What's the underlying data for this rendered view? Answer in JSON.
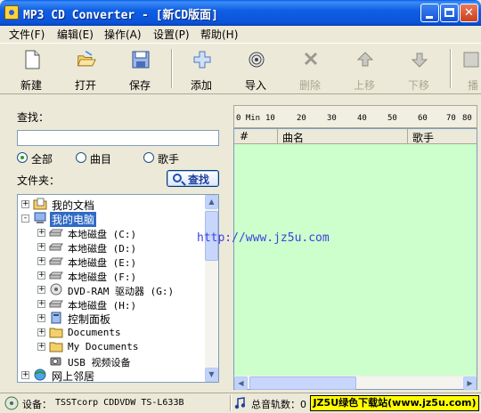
{
  "window": {
    "title": "MP3 CD Converter - [新CD版面]"
  },
  "menu": [
    {
      "label": "文件(F)"
    },
    {
      "label": "编辑(E)"
    },
    {
      "label": "操作(A)"
    },
    {
      "label": "设置(P)"
    },
    {
      "label": "帮助(H)"
    }
  ],
  "toolbar": [
    {
      "label": "新建",
      "icon": "new-file-icon",
      "enabled": true
    },
    {
      "label": "打开",
      "icon": "open-folder-icon",
      "enabled": true
    },
    {
      "label": "保存",
      "icon": "save-disk-icon",
      "enabled": true
    },
    {
      "label": "添加",
      "icon": "add-plus-icon",
      "enabled": true
    },
    {
      "label": "导入",
      "icon": "import-disc-icon",
      "enabled": true
    },
    {
      "label": "删除",
      "icon": "delete-icon",
      "enabled": false
    },
    {
      "label": "上移",
      "icon": "move-up-icon",
      "enabled": false
    },
    {
      "label": "下移",
      "icon": "move-down-icon",
      "enabled": false
    },
    {
      "label": "播",
      "icon": "play-icon",
      "enabled": false
    }
  ],
  "search": {
    "label": "查找：",
    "value": "",
    "options": [
      {
        "label": "全部",
        "selected": true
      },
      {
        "label": "曲目",
        "selected": false
      },
      {
        "label": "歌手",
        "selected": false
      }
    ],
    "folder_label": "文件夹：",
    "button": "查找"
  },
  "tree": [
    {
      "label": "我的文档",
      "icon": "documents-folder-icon",
      "level": 0,
      "expander": "+"
    },
    {
      "label": "我的电脑",
      "icon": "my-computer-icon",
      "level": 0,
      "expander": "-",
      "selected": true
    },
    {
      "label": "本地磁盘 (C:)",
      "icon": "drive-icon",
      "level": 1,
      "expander": "+"
    },
    {
      "label": "本地磁盘 (D:)",
      "icon": "drive-icon",
      "level": 1,
      "expander": "+"
    },
    {
      "label": "本地磁盘 (E:)",
      "icon": "drive-icon",
      "level": 1,
      "expander": "+"
    },
    {
      "label": "本地磁盘 (F:)",
      "icon": "drive-icon",
      "level": 1,
      "expander": "+"
    },
    {
      "label": "DVD-RAM 驱动器 (G:)",
      "icon": "dvd-drive-icon",
      "level": 1,
      "expander": "+"
    },
    {
      "label": "本地磁盘 (H:)",
      "icon": "drive-icon",
      "level": 1,
      "expander": "+"
    },
    {
      "label": "控制面板",
      "icon": "control-panel-icon",
      "level": 1,
      "expander": "+"
    },
    {
      "label": "Documents",
      "icon": "folder-icon",
      "level": 1,
      "expander": "+"
    },
    {
      "label": "My Documents",
      "icon": "folder-icon",
      "level": 1,
      "expander": "+"
    },
    {
      "label": "USB 视频设备",
      "icon": "camera-icon",
      "level": 1,
      "expander": ""
    },
    {
      "label": "网上邻居",
      "icon": "network-icon",
      "level": 0,
      "expander": "+"
    }
  ],
  "ruler": {
    "ticks": [
      "0 Min",
      "10",
      "20",
      "30",
      "40",
      "50",
      "60",
      "70",
      "80"
    ]
  },
  "tracklist": {
    "columns": [
      "#",
      "曲名",
      "歌手"
    ],
    "rows": [],
    "watermark": "http://www.jz5u.com"
  },
  "statusbar": {
    "device_label": "设备：",
    "device_value": "TSSTcorp  CDDVDW TS-L633B",
    "total_label": "总音轨数：0",
    "banner": "JZ5U绿色下载站(www.jz5u.com)"
  },
  "colors": {
    "tracklist_bg": "#CCFFCC",
    "selection": "#316AC5",
    "banner_bg": "#FFFF00"
  }
}
